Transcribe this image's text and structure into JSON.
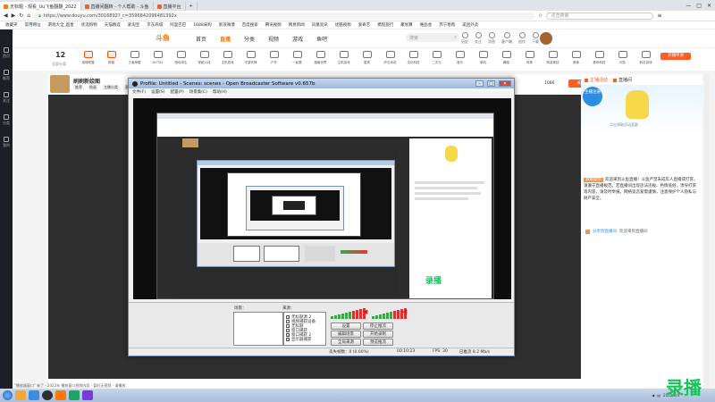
{
  "browser": {
    "tabs": [
      {
        "label": "无标题 - 观看_Uu飞鱼翻翻_2022",
        "color": "#ff7a00"
      },
      {
        "label": "直播间翻转 - 个人帮助 - 斗鱼",
        "color": "#ff5d23"
      },
      {
        "label": "直播平台",
        "color": "#ff5d23"
      }
    ],
    "window_controls": [
      "—",
      "□",
      "✕"
    ],
    "url": "https://www.douyu.com/3016892?_c=3596842096481392x",
    "search_placeholder": "点击搜索",
    "bookmarks": [
      "收藏夹",
      "常用网址",
      "游戏大全_超星",
      "优选购物",
      "天猫精选",
      "爱淘宝",
      "京东商城",
      "阿里巴巴",
      "1688采购",
      "新浪微博",
      "百度搜索",
      "腾讯视频",
      "网易新闻",
      "凤凰资讯",
      "优酷视频",
      "爱奇艺",
      "携程旅行",
      "聚划算",
      "唯品会",
      "苏宁易购",
      "美团外卖"
    ]
  },
  "leftbar": [
    "首页",
    "推荐",
    "关注",
    "分类",
    "我的"
  ],
  "site": {
    "logo": "斗鱼",
    "nav": [
      "首页",
      "直播",
      "分类",
      "视频",
      "游戏",
      "鱼吧"
    ],
    "nav_active": "直播",
    "search_placeholder": "搜索",
    "head_icons": [
      "历史",
      "关注",
      "消息",
      "客户端",
      "创作",
      "下载"
    ],
    "category_count": "12",
    "category_sub": "全部分类",
    "categories": [
      "英雄联盟",
      "颜值",
      "王者荣耀",
      "DOTA2",
      "绝地求生",
      "穿越火线",
      "主机游戏",
      "守望先锋",
      "户外",
      "一起看",
      "魔兽世界",
      "主机游戏",
      "星秀",
      "炉石传说",
      "文化科技",
      "二次元",
      "音乐",
      "单机",
      "舞蹈",
      "体育",
      "网游竞技",
      "美食",
      "数码科技",
      "问答",
      "射击游戏"
    ],
    "open_live_button": "开播申请",
    "room": {
      "title": "刷刷新绘图",
      "tags": [
        "推荐",
        "绘画",
        "主播分类",
        "直播中",
        "粉丝团"
      ],
      "follow_count": "1086",
      "follow_label": "关注"
    },
    "chat": {
      "tabs": [
        "主播活动",
        "直播间"
      ],
      "poster_badge": "主播注册",
      "poster_text": "点击领取活动奖励",
      "system_msg_tag": "系统提示",
      "system_msg": "欢迎来到斗鱼直播！斗鱼严禁未成年人直播或打赏，请遵守直播规范。若直播间出现违法违规、色情低俗、诱导打赏等内容，请及时举报。网络谈恋爱需谨慎，注意保护个人隐私与财产安全。",
      "watermark_line": "分享到直播间",
      "watermark_link": "欢迎来到直播间"
    }
  },
  "obs": {
    "title": "Profile: Untitled - Scenes: scenes - Open Broadcaster Software v0.657b",
    "menu": [
      "文件(F)",
      "设置(S)",
      "配置(P)",
      "场景集(C)",
      "帮助(H)"
    ],
    "scenes_label": "场景：",
    "sources_label": "来源：",
    "sources": [
      {
        "label": "无标题源 2",
        "checked": true
      },
      {
        "label": "视频捕获设备",
        "checked": false
      },
      {
        "label": "无标题",
        "checked": false
      },
      {
        "label": "窗口捕获",
        "checked": false
      },
      {
        "label": "窗口捕获 2",
        "checked": true
      },
      {
        "label": "显示器捕获",
        "checked": true
      }
    ],
    "buttons": [
      "设置",
      "编辑场景",
      "全局来源",
      "插件",
      "停止推流",
      "开始录制",
      "预览推流",
      "退出"
    ],
    "status": [
      "丢失帧数：0 (0.00%)",
      "FPS: 30",
      "00:10:23",
      "已推流 8.2 Mb/s"
    ],
    "overlay_text": "录播"
  },
  "taskbar": {
    "status_text": "\"播放器窗口\" 来了 - 2022年 播放窗口视频内容 - 暂时无视频 - 请播放",
    "clock": "2022/1/4"
  },
  "watermark": "录播"
}
